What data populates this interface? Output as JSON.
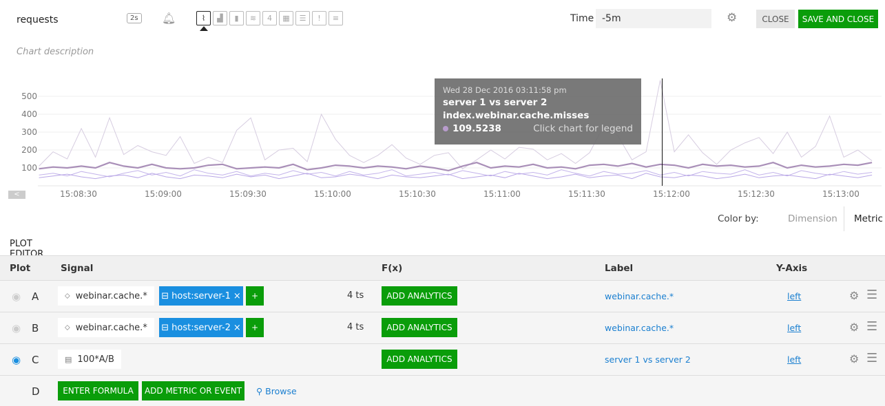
{
  "header": {
    "title": "requests",
    "resolution": "2s",
    "description_placeholder": "Chart description",
    "time_label": "Time",
    "time_value": "-5m",
    "close_label": "CLOSE",
    "save_label": "SAVE AND CLOSE",
    "chart_types": [
      {
        "name": "line",
        "glyph": "⌇",
        "selected": true
      },
      {
        "name": "area",
        "glyph": "▟"
      },
      {
        "name": "column",
        "glyph": "▮"
      },
      {
        "name": "histogram",
        "glyph": "≋"
      },
      {
        "name": "single-value",
        "glyph": "4"
      },
      {
        "name": "heatmap",
        "glyph": "▦"
      },
      {
        "name": "list",
        "glyph": "☰"
      },
      {
        "name": "event-feed",
        "glyph": "!"
      },
      {
        "name": "text",
        "glyph": "≡"
      }
    ]
  },
  "tooltip": {
    "date": "Wed 28 Dec 2016 03:11:58 pm",
    "series": "server 1 vs server 2",
    "metric": "index.webinar.cache.misses",
    "value": "109.5238",
    "hint": "Click chart for legend"
  },
  "chart_data": {
    "type": "line",
    "y_ticks": [
      100,
      200,
      300,
      400,
      500
    ],
    "x_ticks": [
      "15:08:30",
      "15:09:00",
      "15:09:30",
      "15:10:00",
      "15:10:30",
      "15:11:00",
      "15:11:30",
      "15:12:00",
      "15:12:30",
      "15:13:00"
    ],
    "x_start": "15:08:16",
    "x_interval_s": 5,
    "ylim": [
      0,
      580
    ],
    "grid": true,
    "series": [
      {
        "color": "#d6cce0",
        "width": 1,
        "values": [
          110,
          190,
          150,
          320,
          160,
          380,
          175,
          225,
          190,
          170,
          275,
          125,
          160,
          130,
          310,
          380,
          145,
          200,
          210,
          135,
          400,
          260,
          170,
          130,
          170,
          230,
          155,
          120,
          170,
          185,
          95,
          145,
          200,
          150,
          215,
          205,
          145,
          180,
          125,
          185,
          335,
          280,
          145,
          190,
          590,
          190,
          285,
          185,
          120,
          200,
          240,
          270,
          180,
          300,
          160,
          220,
          390,
          160,
          200,
          140
        ]
      },
      {
        "color": "#a98fb8",
        "width": 2.2,
        "values": [
          95,
          105,
          100,
          110,
          100,
          130,
          110,
          100,
          120,
          100,
          95,
          100,
          115,
          120,
          95,
          100,
          105,
          100,
          120,
          90,
          100,
          115,
          110,
          100,
          110,
          105,
          95,
          110,
          100,
          85,
          110,
          130,
          100,
          110,
          105,
          120,
          100,
          105,
          95,
          115,
          120,
          110,
          125,
          105,
          120,
          115,
          100,
          120,
          110,
          115,
          105,
          110,
          130,
          100,
          115,
          105,
          110,
          120,
          115,
          130
        ]
      },
      {
        "color": "#c2b2ea",
        "width": 1,
        "values": [
          60,
          70,
          55,
          80,
          65,
          50,
          70,
          85,
          60,
          75,
          55,
          90,
          70,
          60,
          80,
          55,
          70,
          60,
          85,
          65,
          75,
          55,
          80,
          60,
          70,
          90,
          55,
          65,
          75,
          60,
          85,
          70,
          55,
          80,
          65,
          75,
          60,
          90,
          70,
          55,
          80,
          65,
          70,
          85,
          60,
          75,
          55,
          80,
          70,
          65,
          90,
          60,
          75,
          55,
          85,
          70,
          60,
          80,
          65,
          75
        ]
      },
      {
        "color": "#b8a6e6",
        "width": 1,
        "values": [
          45,
          55,
          65,
          50,
          40,
          55,
          60,
          45,
          70,
          50,
          40,
          60,
          55,
          45,
          65,
          50,
          60,
          40,
          55,
          70,
          45,
          50,
          65,
          55,
          40,
          60,
          50,
          45,
          55,
          65,
          40,
          50,
          60,
          45,
          70,
          55,
          40,
          50,
          65,
          45,
          55,
          60,
          40,
          70,
          50,
          45,
          60,
          55,
          40,
          50,
          65,
          45,
          55,
          60,
          50,
          40,
          65,
          55,
          45,
          60
        ]
      }
    ]
  },
  "color_by": {
    "label": "Color by:",
    "options": [
      "Dimension",
      "Metric"
    ],
    "selected": "Metric"
  },
  "plot_editor": {
    "tab": "PLOT EDITOR",
    "columns": [
      "Plot",
      "Signal",
      "F(x)",
      "Label",
      "Y-Axis"
    ],
    "rows": [
      {
        "letter": "A",
        "visible": false,
        "signal": "webinar.cache.*",
        "filter": "host:server-1",
        "ts": "4 ts",
        "analytics": "ADD ANALYTICS",
        "label": "webinar.cache.*",
        "yaxis": "left"
      },
      {
        "letter": "B",
        "visible": false,
        "signal": "webinar.cache.*",
        "filter": "host:server-2",
        "ts": "4 ts",
        "analytics": "ADD ANALYTICS",
        "label": "webinar.cache.*",
        "yaxis": "left"
      },
      {
        "letter": "C",
        "visible": true,
        "signal": "100*A/B",
        "analytics": "ADD ANALYTICS",
        "label": "server 1 vs server 2",
        "yaxis": "left"
      }
    ],
    "new_row": {
      "letter": "D",
      "formula": "ENTER FORMULA",
      "add_metric": "ADD METRIC OR EVENT",
      "browse": "Browse"
    }
  }
}
